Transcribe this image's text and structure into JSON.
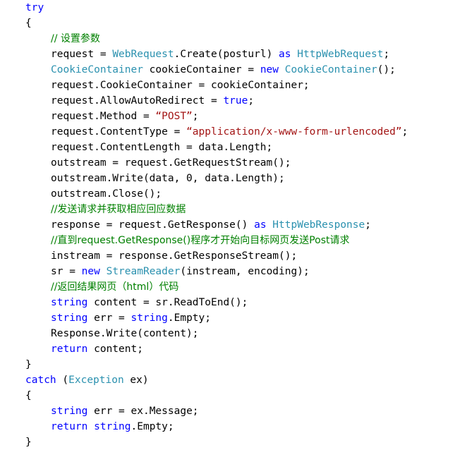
{
  "editor": {
    "language": "csharp",
    "background": "#ffffff",
    "colors": {
      "keyword": "#0000ff",
      "type": "#2b91af",
      "string": "#a31515",
      "comment": "#008000",
      "plain": "#000000"
    },
    "lines": [
      {
        "indent": 0,
        "tokens": [
          {
            "t": "try",
            "c": "kw"
          }
        ]
      },
      {
        "indent": 0,
        "tokens": [
          {
            "t": "{",
            "c": "pln"
          }
        ]
      },
      {
        "indent": 1,
        "tokens": [
          {
            "t": "// 设置参数",
            "c": "cmt"
          }
        ]
      },
      {
        "indent": 1,
        "tokens": [
          {
            "t": "request = ",
            "c": "pln"
          },
          {
            "t": "WebRequest",
            "c": "type"
          },
          {
            "t": ".Create(posturl) ",
            "c": "pln"
          },
          {
            "t": "as",
            "c": "kw"
          },
          {
            "t": " ",
            "c": "pln"
          },
          {
            "t": "HttpWebRequest",
            "c": "type"
          },
          {
            "t": ";",
            "c": "pln"
          }
        ]
      },
      {
        "indent": 1,
        "tokens": [
          {
            "t": "CookieContainer",
            "c": "type"
          },
          {
            "t": " cookieContainer = ",
            "c": "pln"
          },
          {
            "t": "new",
            "c": "kw"
          },
          {
            "t": " ",
            "c": "pln"
          },
          {
            "t": "CookieContainer",
            "c": "type"
          },
          {
            "t": "();",
            "c": "pln"
          }
        ]
      },
      {
        "indent": 1,
        "tokens": [
          {
            "t": "request.CookieContainer = cookieContainer;",
            "c": "pln"
          }
        ]
      },
      {
        "indent": 1,
        "tokens": [
          {
            "t": "request.AllowAutoRedirect = ",
            "c": "pln"
          },
          {
            "t": "true",
            "c": "kw"
          },
          {
            "t": ";",
            "c": "pln"
          }
        ]
      },
      {
        "indent": 1,
        "tokens": [
          {
            "t": "request.Method = ",
            "c": "pln"
          },
          {
            "t": "“POST”",
            "c": "str"
          },
          {
            "t": ";",
            "c": "pln"
          }
        ]
      },
      {
        "indent": 1,
        "tokens": [
          {
            "t": "request.ContentType = ",
            "c": "pln"
          },
          {
            "t": "“application/x-www-form-urlencoded”",
            "c": "str"
          },
          {
            "t": ";",
            "c": "pln"
          }
        ]
      },
      {
        "indent": 1,
        "tokens": [
          {
            "t": "request.ContentLength = data.Length;",
            "c": "pln"
          }
        ]
      },
      {
        "indent": 1,
        "tokens": [
          {
            "t": "outstream = request.GetRequestStream();",
            "c": "pln"
          }
        ]
      },
      {
        "indent": 1,
        "tokens": [
          {
            "t": "outstream.Write(data, 0, data.Length);",
            "c": "pln"
          }
        ]
      },
      {
        "indent": 1,
        "tokens": [
          {
            "t": "outstream.Close();",
            "c": "pln"
          }
        ]
      },
      {
        "indent": 1,
        "tokens": [
          {
            "t": "//发送请求并获取相应回应数据",
            "c": "cmt"
          }
        ]
      },
      {
        "indent": 1,
        "tokens": [
          {
            "t": "response = request.GetResponse() ",
            "c": "pln"
          },
          {
            "t": "as",
            "c": "kw"
          },
          {
            "t": " ",
            "c": "pln"
          },
          {
            "t": "HttpWebResponse",
            "c": "type"
          },
          {
            "t": ";",
            "c": "pln"
          }
        ]
      },
      {
        "indent": 1,
        "tokens": [
          {
            "t": "//直到request.GetResponse()程序才开始向目标网页发送Post请求",
            "c": "cmt"
          }
        ]
      },
      {
        "indent": 1,
        "tokens": [
          {
            "t": "instream = response.GetResponseStream();",
            "c": "pln"
          }
        ]
      },
      {
        "indent": 1,
        "tokens": [
          {
            "t": "sr = ",
            "c": "pln"
          },
          {
            "t": "new",
            "c": "kw"
          },
          {
            "t": " ",
            "c": "pln"
          },
          {
            "t": "StreamReader",
            "c": "type"
          },
          {
            "t": "(instream, encoding);",
            "c": "pln"
          }
        ]
      },
      {
        "indent": 1,
        "tokens": [
          {
            "t": "//返回结果网页（html）代码",
            "c": "cmt"
          }
        ]
      },
      {
        "indent": 1,
        "tokens": [
          {
            "t": "string",
            "c": "kw"
          },
          {
            "t": " content = sr.ReadToEnd();",
            "c": "pln"
          }
        ]
      },
      {
        "indent": 1,
        "tokens": [
          {
            "t": "string",
            "c": "kw"
          },
          {
            "t": " err = ",
            "c": "pln"
          },
          {
            "t": "string",
            "c": "kw"
          },
          {
            "t": ".Empty;",
            "c": "pln"
          }
        ]
      },
      {
        "indent": 1,
        "tokens": [
          {
            "t": "Response.Write(content);",
            "c": "pln"
          }
        ]
      },
      {
        "indent": 1,
        "tokens": [
          {
            "t": "return",
            "c": "kw"
          },
          {
            "t": " content;",
            "c": "pln"
          }
        ]
      },
      {
        "indent": 0,
        "tokens": [
          {
            "t": "}",
            "c": "pln"
          }
        ]
      },
      {
        "indent": 0,
        "tokens": [
          {
            "t": "catch",
            "c": "kw"
          },
          {
            "t": " (",
            "c": "pln"
          },
          {
            "t": "Exception",
            "c": "type"
          },
          {
            "t": " ex)",
            "c": "pln"
          }
        ]
      },
      {
        "indent": 0,
        "tokens": [
          {
            "t": "{",
            "c": "pln"
          }
        ]
      },
      {
        "indent": 1,
        "tokens": [
          {
            "t": "string",
            "c": "kw"
          },
          {
            "t": " err = ex.Message;",
            "c": "pln"
          }
        ]
      },
      {
        "indent": 1,
        "tokens": [
          {
            "t": "return",
            "c": "kw"
          },
          {
            "t": " ",
            "c": "pln"
          },
          {
            "t": "string",
            "c": "kw"
          },
          {
            "t": ".Empty;",
            "c": "pln"
          }
        ]
      },
      {
        "indent": 0,
        "tokens": [
          {
            "t": "}",
            "c": "pln"
          }
        ]
      }
    ]
  }
}
